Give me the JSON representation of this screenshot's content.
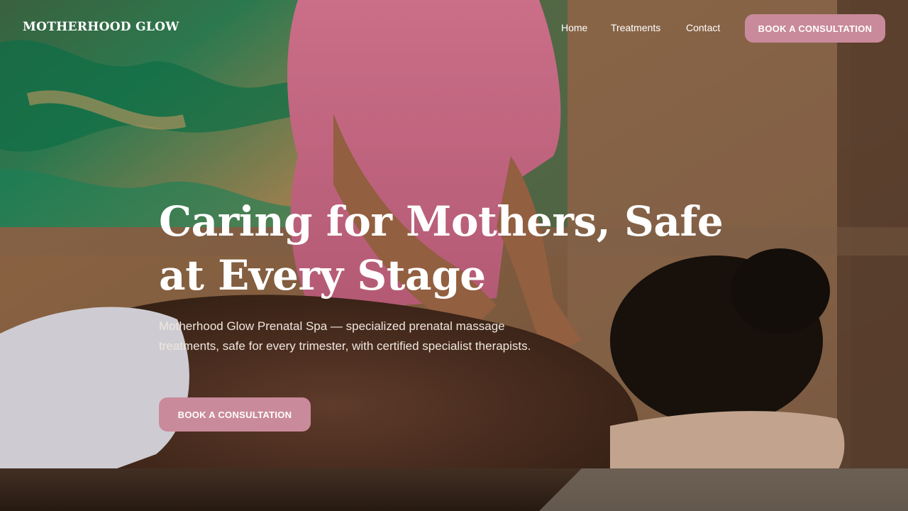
{
  "header": {
    "brand": "MOTHERHOOD GLOW",
    "nav": {
      "home": "Home",
      "treatments": "Treatments",
      "contact": "Contact"
    },
    "cta_label": "BOOK A CONSULTATION"
  },
  "hero": {
    "headline": "Caring for Mothers, Safe at Every Stage",
    "subcopy": "Motherhood Glow Prenatal Spa — specialized prenatal massage treatments, safe for every trimester, with certified specialist therapists.",
    "cta_label": "BOOK A CONSULTATION",
    "image": "prenatal-massage-photo"
  },
  "colors": {
    "accent": "#c98a9b",
    "text": "#ffffff",
    "subtext": "#efe6de"
  }
}
